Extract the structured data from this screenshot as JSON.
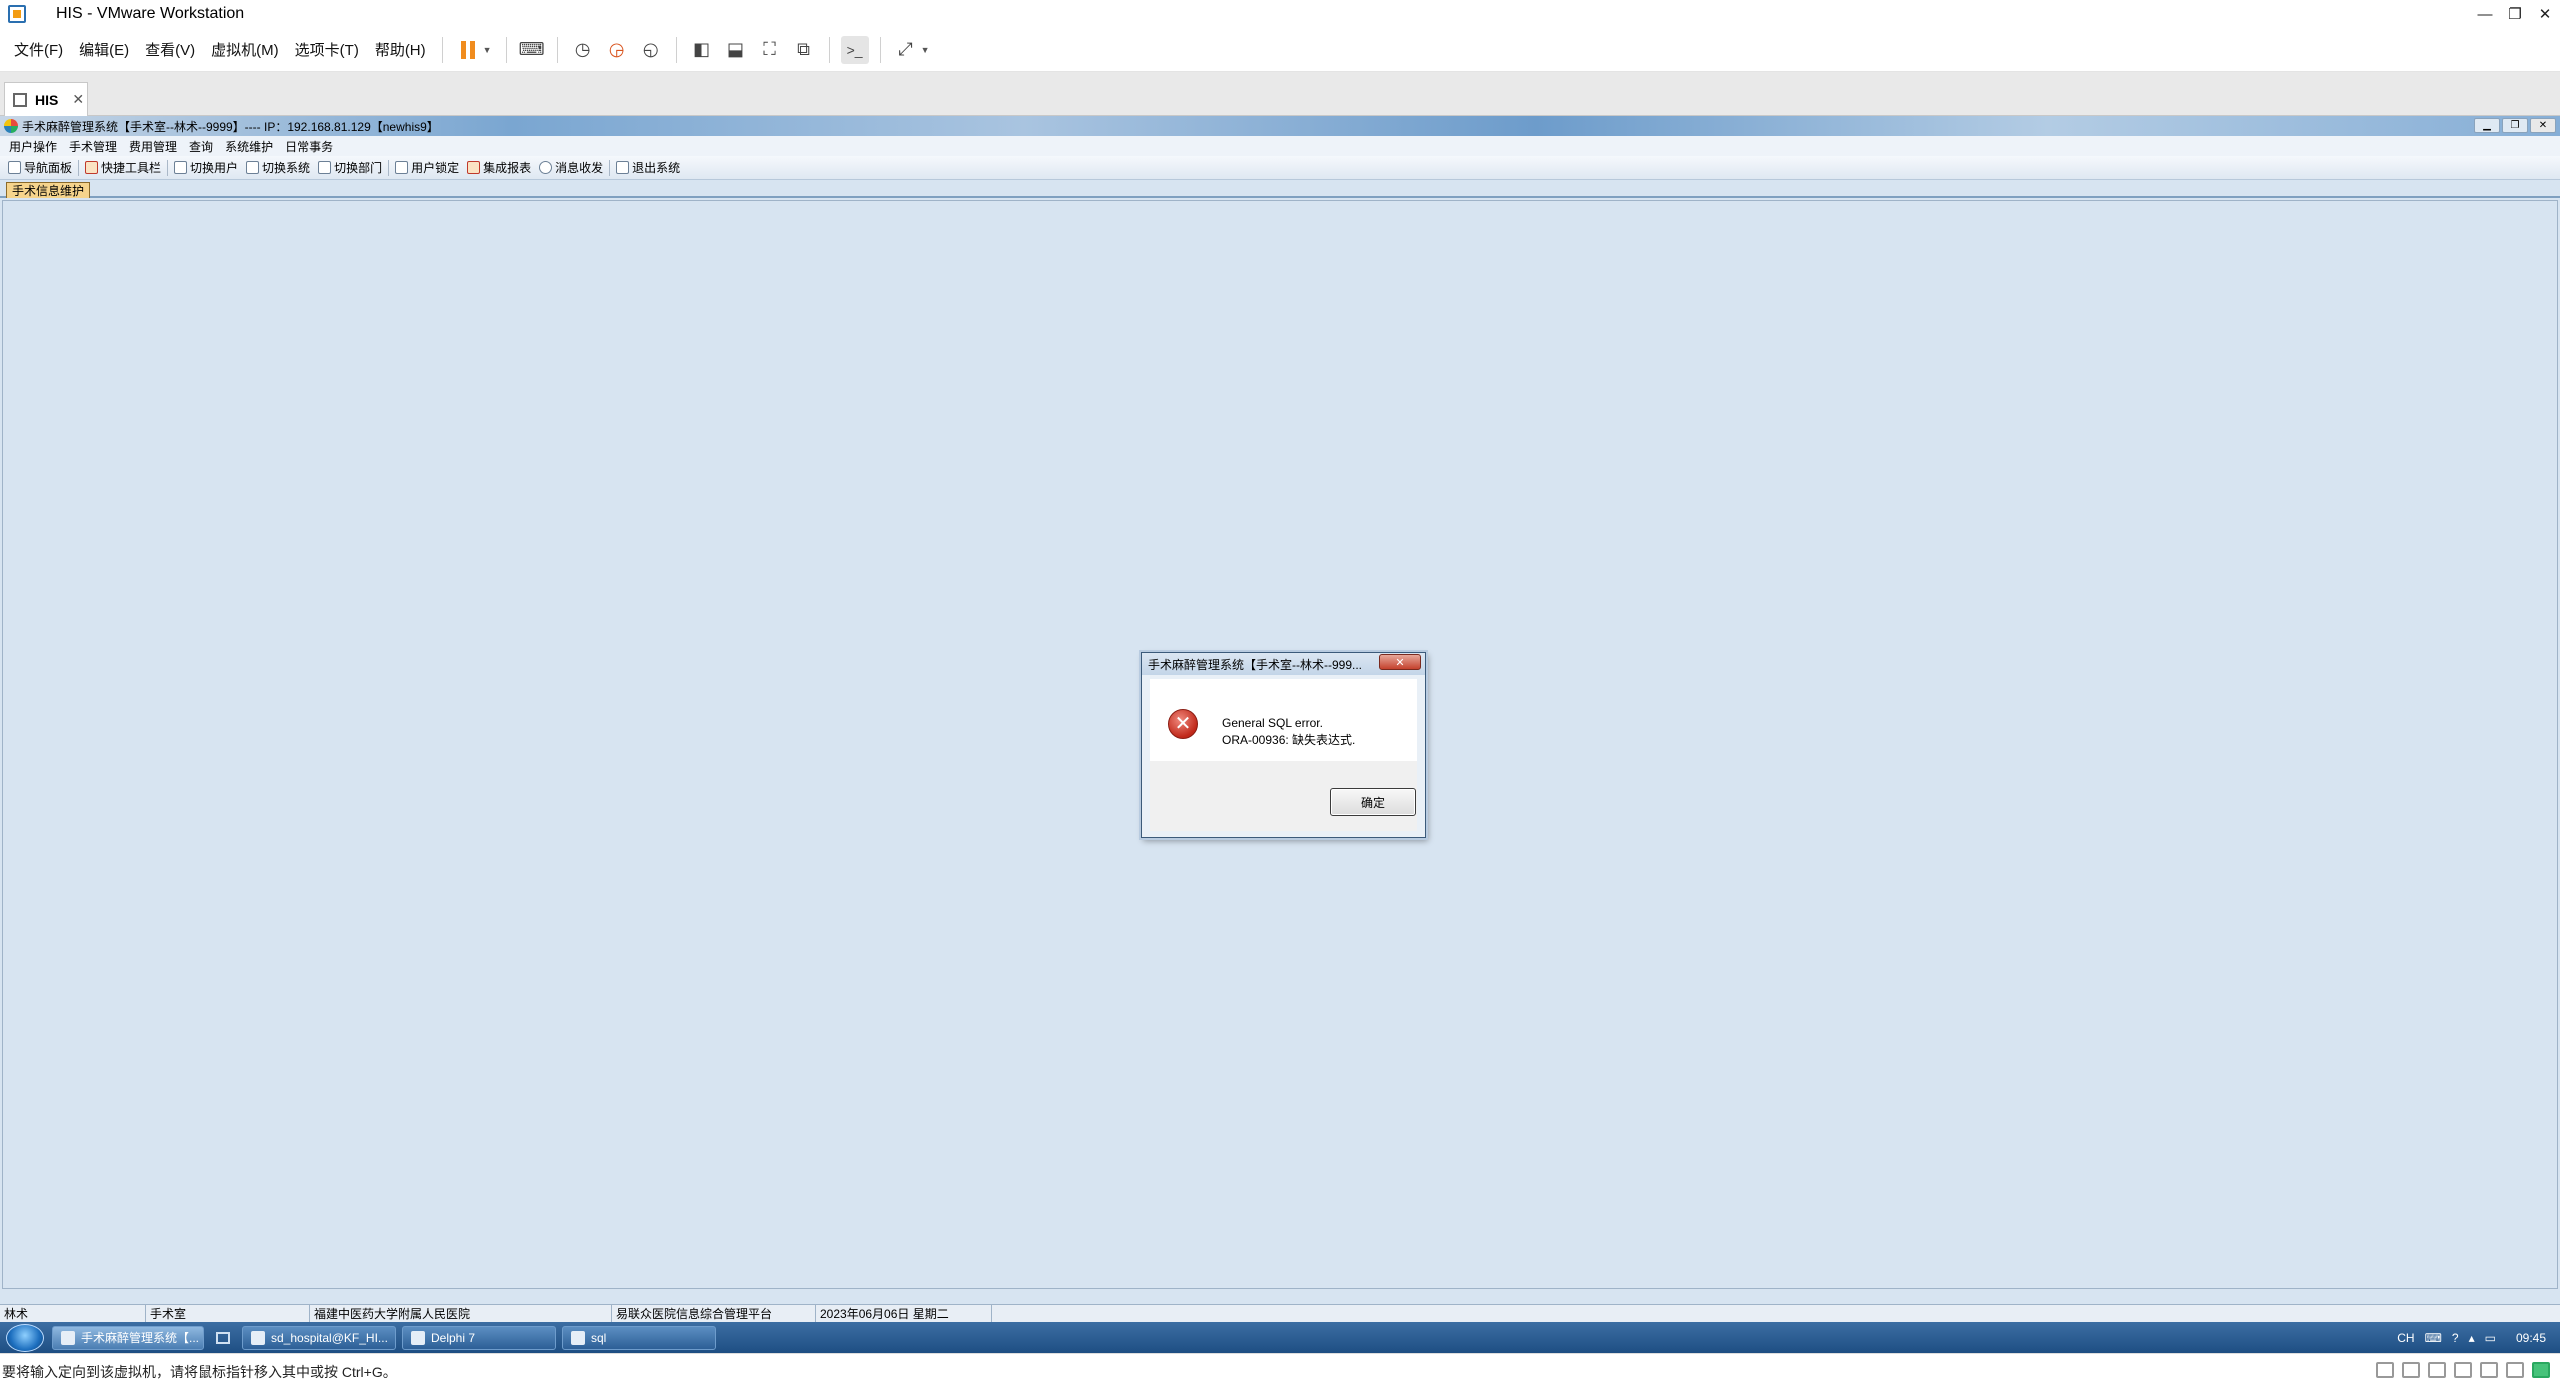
{
  "vmware": {
    "title": "HIS - VMware Workstation",
    "window_controls": [
      "—",
      "❐",
      "✕"
    ],
    "menus": [
      "文件(F)",
      "编辑(E)",
      "查看(V)",
      "虚拟机(M)",
      "选项卡(T)",
      "帮助(H)"
    ],
    "tab": {
      "label": "HIS",
      "close": "✕"
    },
    "status_text": "要将输入定向到该虚拟机，请将鼠标指针移入其中或按 Ctrl+G。"
  },
  "his": {
    "title": "手术麻醉管理系统【手术室--林术--9999】---- IP：192.168.81.129【newhis9】",
    "menus": [
      "用户操作",
      "手术管理",
      "费用管理",
      "查询",
      "系统维护",
      "日常事务"
    ],
    "toolbar": [
      "导航面板",
      "快捷工具栏",
      "切换用户",
      "切换系统",
      "切换部门",
      "用户锁定",
      "集成报表",
      "消息收发",
      "退出系统"
    ],
    "active_tab": "手术信息维护",
    "status": {
      "user": "林术",
      "dept": "手术室",
      "hospital": "福建中医药大学附属人民医院",
      "platform": "易联众医院信息综合管理平台",
      "date": "2023年06月06日  星期二"
    }
  },
  "dialog": {
    "title": "手术麻醉管理系统【手术室--林术--999...",
    "close": "✕",
    "message_line1": "General SQL error.",
    "message_line2": "ORA-00936: 缺失表达式.",
    "ok_label": "确定"
  },
  "taskbar": {
    "items": [
      "手术麻醉管理系统【...",
      "sd_hospital@KF_HI...",
      "Delphi 7",
      "sql"
    ],
    "tray_lang": "CH",
    "clock": "09:45"
  }
}
